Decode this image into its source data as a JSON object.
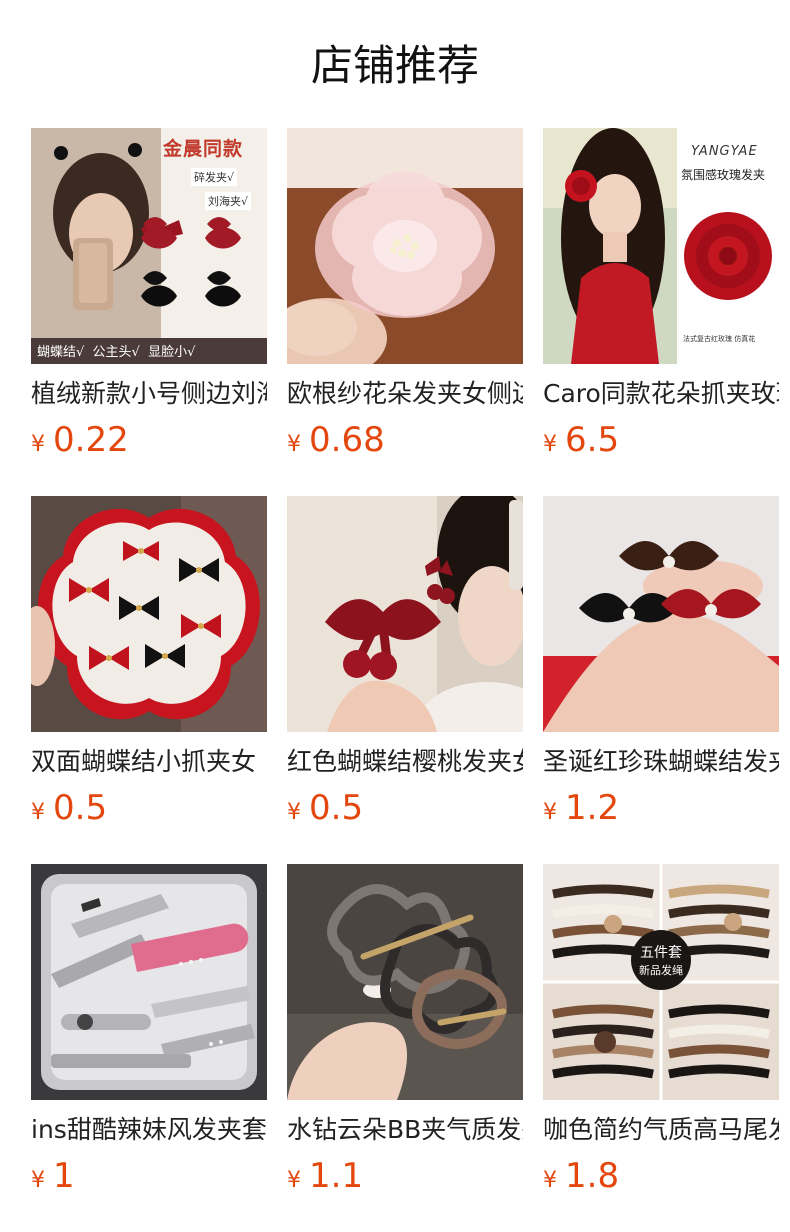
{
  "header": {
    "title": "店铺推荐"
  },
  "currency_symbol": "¥",
  "colors": {
    "price": "#e4470e",
    "text": "#222222"
  },
  "products": [
    {
      "name": "植绒新款小号侧边刘海",
      "price": "0.22",
      "image": {
        "icon": "hair-clip-photo",
        "headline": "金晨同款",
        "tags": [
          "碎发夹√",
          "刘海夹√"
        ],
        "bottom_banner": "蝴蝶结√  公主头√  显脸小√"
      }
    },
    {
      "name": "欧根纱花朵发夹女侧边",
      "price": "0.68",
      "image": {
        "icon": "pink-organza-flower-photo"
      }
    },
    {
      "name": "Caro同款花朵抓夹玫瑰",
      "price": "6.5",
      "image": {
        "icon": "red-rose-clip-photo",
        "brand": "YANGYAE",
        "headline": "氛围感玫瑰发夹",
        "caption": "法式复古红玫瑰 仿真花"
      }
    },
    {
      "name": "双面蝴蝶结小抓夹女",
      "price": "0.5",
      "image": {
        "icon": "bow-claw-clips-photo"
      }
    },
    {
      "name": "红色蝴蝶结樱桃发夹女",
      "price": "0.5",
      "image": {
        "icon": "cherry-bow-clip-photo"
      }
    },
    {
      "name": "圣诞红珍珠蝴蝶结发夹",
      "price": "1.2",
      "image": {
        "icon": "pearl-bow-clips-photo"
      }
    },
    {
      "name": "ins甜酷辣妹风发夹套装",
      "price": "1",
      "image": {
        "icon": "metal-hairpins-photo"
      }
    },
    {
      "name": "水钻云朵BB夹气质发夹",
      "price": "1.1",
      "image": {
        "icon": "rhinestone-cloud-clip-photo"
      }
    },
    {
      "name": "咖色简约气质高马尾发绳",
      "price": "1.8",
      "image": {
        "icon": "hair-ties-photo",
        "badge_line1": "五件套",
        "badge_line2": "新品发绳"
      }
    }
  ]
}
